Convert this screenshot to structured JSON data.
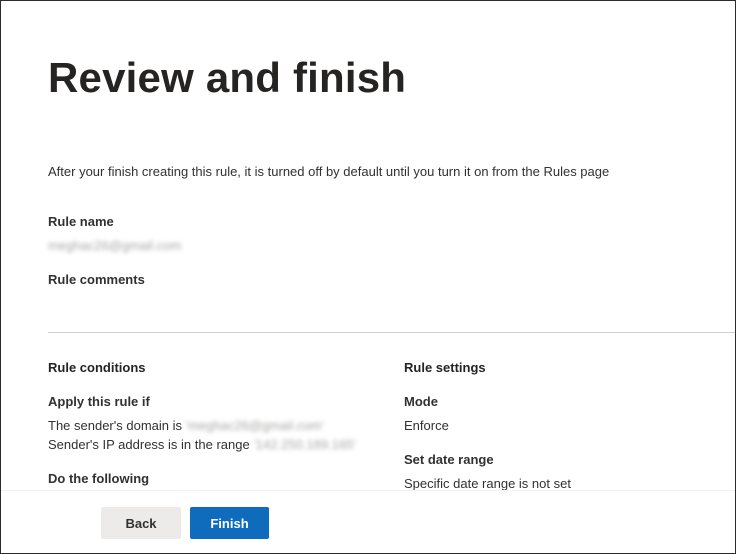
{
  "page": {
    "title": "Review and finish",
    "intro": "After your finish creating this rule, it is turned off by default until you turn it on from the Rules page"
  },
  "rule": {
    "name_label": "Rule name",
    "name_value": "meghac26@gmail.com",
    "comments_label": "Rule comments"
  },
  "conditions": {
    "heading": "Rule conditions",
    "apply_label": "Apply this rule if",
    "sender_domain_prefix": "The sender's domain is",
    "sender_domain_value": "'meghac26@gmail.com'",
    "sender_ip_prefix": "Sender's IP address is in the range",
    "sender_ip_value": "'142.250.189.165'",
    "do_following_label": "Do the following"
  },
  "settings": {
    "heading": "Rule settings",
    "mode_label": "Mode",
    "mode_value": "Enforce",
    "date_range_label": "Set date range",
    "date_range_value": "Specific date range is not set"
  },
  "footer": {
    "back_label": "Back",
    "finish_label": "Finish"
  },
  "colors": {
    "primary": "#0f6cbd",
    "secondary_button": "#edebe9",
    "text": "#323130"
  }
}
